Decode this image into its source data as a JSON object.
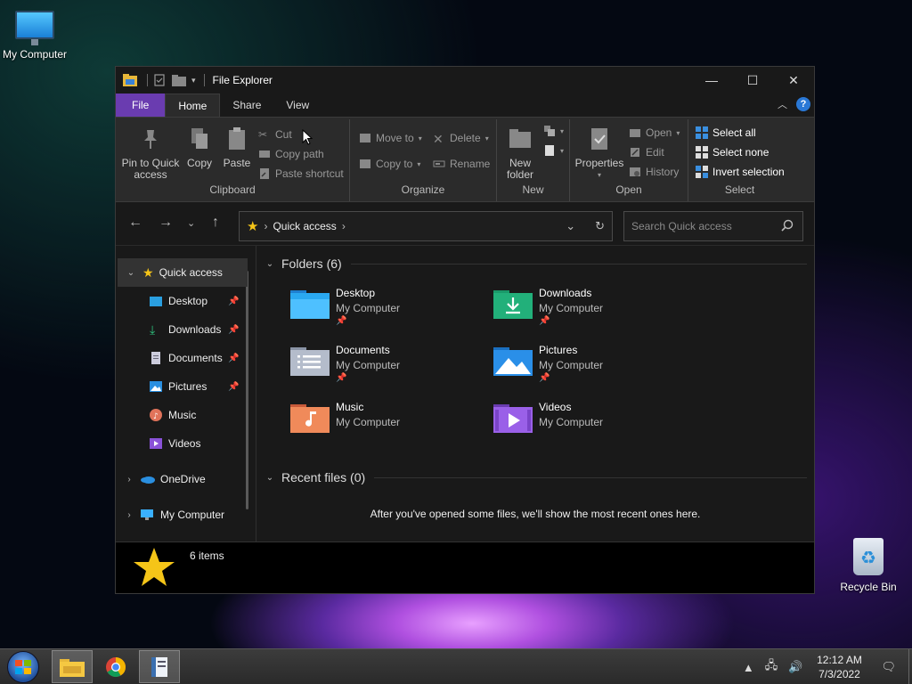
{
  "desktop": {
    "my_computer_label": "My Computer",
    "recycle_bin_label": "Recycle Bin"
  },
  "window": {
    "title": "File Explorer",
    "controls": {
      "minimize": "—",
      "maximize": "☐",
      "close": "✕"
    }
  },
  "tabs": {
    "file": "File",
    "home": "Home",
    "share": "Share",
    "view": "View",
    "help": "?"
  },
  "ribbon": {
    "clipboard": {
      "label": "Clipboard",
      "pin_line1": "Pin to Quick",
      "pin_line2": "access",
      "copy": "Copy",
      "paste": "Paste",
      "cut": "Cut",
      "copy_path": "Copy path",
      "paste_shortcut": "Paste shortcut"
    },
    "organize": {
      "label": "Organize",
      "move_to": "Move to",
      "copy_to": "Copy to",
      "delete": "Delete",
      "rename": "Rename"
    },
    "new": {
      "label": "New",
      "new_folder_line1": "New",
      "new_folder_line2": "folder"
    },
    "open": {
      "label": "Open",
      "properties": "Properties",
      "open": "Open",
      "edit": "Edit",
      "history": "History"
    },
    "select": {
      "label": "Select",
      "select_all": "Select all",
      "select_none": "Select none",
      "invert_selection": "Invert selection"
    }
  },
  "address": {
    "location": "Quick access",
    "search_placeholder": "Search Quick access"
  },
  "sidebar": {
    "quick_access": "Quick access",
    "items": [
      {
        "label": "Desktop"
      },
      {
        "label": "Downloads"
      },
      {
        "label": "Documents"
      },
      {
        "label": "Pictures"
      },
      {
        "label": "Music"
      },
      {
        "label": "Videos"
      }
    ],
    "onedrive": "OneDrive",
    "my_computer": "My Computer"
  },
  "main": {
    "folders_heading": "Folders (6)",
    "folders": [
      {
        "name": "Desktop",
        "location": "My Computer"
      },
      {
        "name": "Downloads",
        "location": "My Computer"
      },
      {
        "name": "Documents",
        "location": "My Computer"
      },
      {
        "name": "Pictures",
        "location": "My Computer"
      },
      {
        "name": "Music",
        "location": "My Computer"
      },
      {
        "name": "Videos",
        "location": "My Computer"
      }
    ],
    "recent_heading": "Recent files (0)",
    "recent_empty": "After you've opened some files, we'll show the most recent ones here."
  },
  "details": {
    "item_count": "6 items"
  },
  "taskbar": {
    "time": "12:12 AM",
    "date": "7/3/2022"
  },
  "colors": {
    "file_tab": "#6a3cb0",
    "accent_blue": "#2a78d6",
    "star": "#f5c518"
  }
}
